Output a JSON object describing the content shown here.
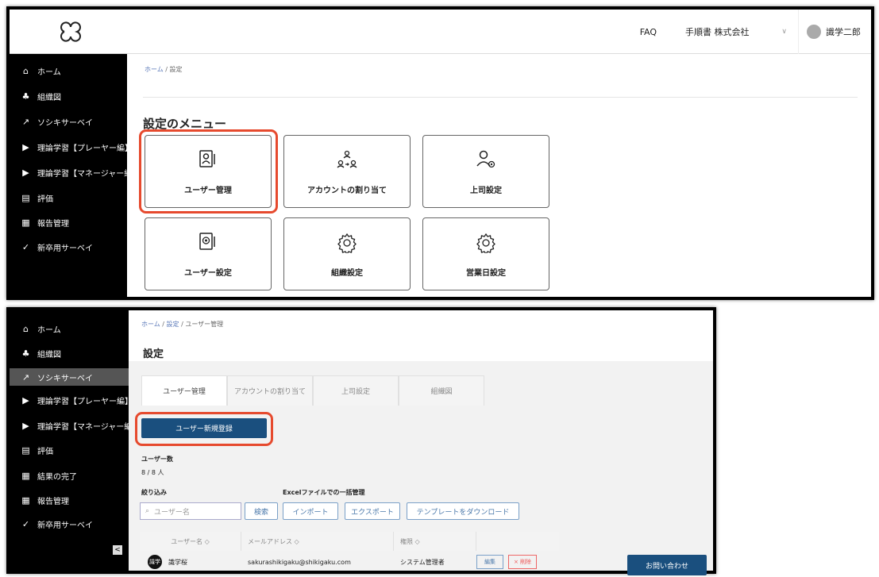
{
  "shot1": {
    "header": {
      "faq": "FAQ",
      "company": "手順書 株式会社",
      "user": "識学二郎"
    },
    "sidebar": [
      {
        "icon": "home-icon",
        "glyph": "⌂",
        "label": "ホーム"
      },
      {
        "icon": "org-chart-icon",
        "glyph": "♣",
        "label": "組織図"
      },
      {
        "icon": "chart-icon",
        "glyph": "↗",
        "label": "ソシキサーベイ"
      },
      {
        "icon": "play-icon",
        "glyph": "▶",
        "label": "理論学習【プレーヤー編】"
      },
      {
        "icon": "play-icon",
        "glyph": "▶",
        "label": "理論学習【マネージャー編】"
      },
      {
        "icon": "document-icon",
        "glyph": "▤",
        "label": "評価"
      },
      {
        "icon": "table-icon",
        "glyph": "▦",
        "label": "報告管理"
      },
      {
        "icon": "survey-icon",
        "glyph": "✓",
        "label": "新卒用サーベイ"
      }
    ],
    "breadcrumb": {
      "home": "ホーム",
      "sep": " / ",
      "current": "設定"
    },
    "heading": "設定のメニュー",
    "cards": [
      {
        "label": "ユーザー管理",
        "icon": "user-card-icon"
      },
      {
        "label": "アカウントの割り当て",
        "icon": "account-assign-icon"
      },
      {
        "label": "上司設定",
        "icon": "user-gear-icon"
      },
      {
        "label": "ユーザー設定",
        "icon": "user-settings-icon"
      },
      {
        "label": "組織設定",
        "icon": "gear-icon"
      },
      {
        "label": "営業日設定",
        "icon": "gear-icon"
      }
    ]
  },
  "shot2": {
    "sidebar": [
      {
        "icon": "home-icon",
        "glyph": "⌂",
        "label": "ホーム"
      },
      {
        "icon": "org-chart-icon",
        "glyph": "♣",
        "label": "組織図"
      },
      {
        "icon": "chart-icon",
        "glyph": "↗",
        "label": "ソシキサーベイ"
      },
      {
        "icon": "play-icon",
        "glyph": "▶",
        "label": "理論学習【プレーヤー編】"
      },
      {
        "icon": "play-icon",
        "glyph": "▶",
        "label": "理論学習【マネージャー編】"
      },
      {
        "icon": "document-icon",
        "glyph": "▤",
        "label": "評価"
      },
      {
        "icon": "table-icon",
        "glyph": "▦",
        "label": "結果の完了"
      },
      {
        "icon": "table-icon",
        "glyph": "▦",
        "label": "報告管理"
      },
      {
        "icon": "survey-icon",
        "glyph": "✓",
        "label": "新卒用サーベイ"
      }
    ],
    "breadcrumb": {
      "home": "ホーム",
      "settings": "設定",
      "current": "ユーザー管理",
      "sep": " / "
    },
    "title": "設定",
    "tabs": [
      "ユーザー管理",
      "アカウントの割り当て",
      "上司設定",
      "組織図"
    ],
    "new_user_button": "ユーザー新規登録",
    "user_count_label": "ユーザー数",
    "user_count_value": "8 / 8 人",
    "filter_label": "絞り込み",
    "excel_label": "Excelファイルでの一括管理",
    "search_placeholder": "ユーザー名",
    "search_button": "検索",
    "import_button": "インポート",
    "export_button": "エクスポート",
    "template_button": "テンプレートをダウンロード",
    "table": {
      "headers": [
        "ユーザー名 ◇",
        "メールアドレス ◇",
        "権限 ◇",
        ""
      ],
      "row": {
        "avatar": "識学",
        "name": "識学桜",
        "email": "sakurashikigaku@shikigaku.com",
        "role": "システム管理者",
        "edit": "編集",
        "delete": "× 削除"
      }
    },
    "contact_button": "お問い合わせ",
    "collapse_glyph": "<"
  }
}
